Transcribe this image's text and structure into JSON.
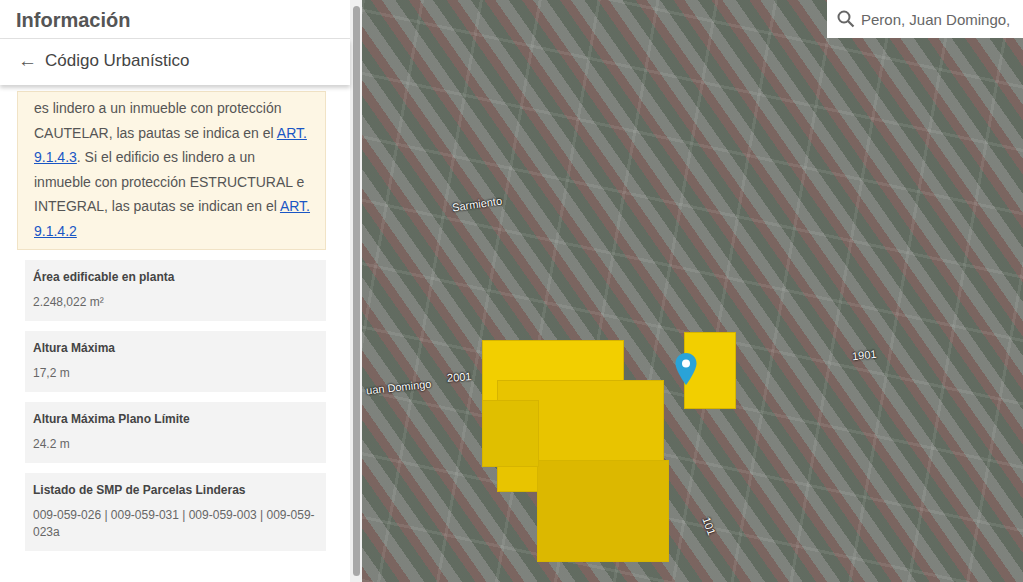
{
  "panel": {
    "title": "Información",
    "back": {
      "icon": "←",
      "label": "Código Urbanístico"
    },
    "note": [
      {
        "text": "es lindero a un inmueble con protección CAUTELAR, las pautas se indica en el ",
        "link": false
      },
      {
        "text": "ART. 9.1.4.3",
        "link": true
      },
      {
        "text": ". Si el edificio es lindero a un inmueble con protección ESTRUCTURAL e INTEGRAL, las pautas se indican en el ",
        "link": false
      },
      {
        "text": "ART. 9.1.4.2",
        "link": true
      }
    ],
    "fields": [
      {
        "label": "Área edificable en planta",
        "value": "2.248,022 m²"
      },
      {
        "label": "Altura Máxima",
        "value": "17,2 m"
      },
      {
        "label": "Altura Máxima Plano Límite",
        "value": "24.2 m"
      },
      {
        "label": "Listado de SMP de Parcelas Linderas",
        "value": "009-059-026 | 009-059-031 | 009-059-003 | 009-059-023a"
      }
    ]
  },
  "search": {
    "value": "Peron, Juan Domingo,"
  },
  "map": {
    "labels": [
      "Sarmiento",
      "2001",
      "1901",
      "uan Domingo",
      "101"
    ]
  }
}
